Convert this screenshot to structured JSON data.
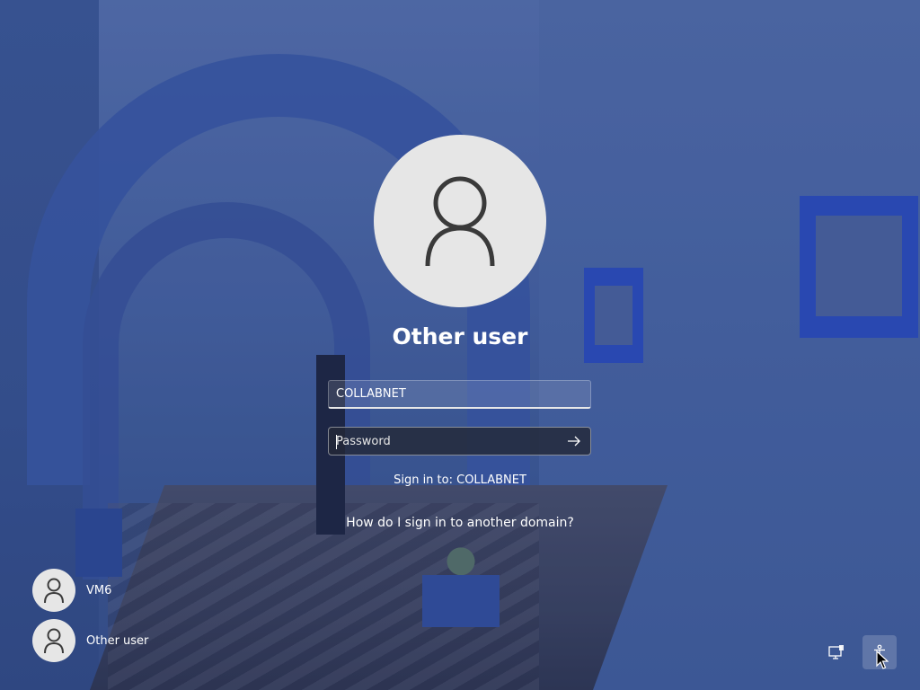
{
  "login": {
    "user_title": "Other user",
    "username_value": "COLLABNET",
    "password_placeholder": "Password",
    "sign_in_to": "Sign in to: COLLABNET",
    "domain_help_link": "How do I sign in to another domain?"
  },
  "user_list": [
    {
      "name": "VM6",
      "icon": "user-icon"
    },
    {
      "name": "Other user",
      "icon": "user-icon"
    }
  ],
  "system_icons": {
    "network": "network-icon",
    "accessibility": "accessibility-icon"
  },
  "colors": {
    "accent_blue": "#2e52c9",
    "avatar_bg": "#e6e6e6",
    "text": "#ffffff"
  }
}
